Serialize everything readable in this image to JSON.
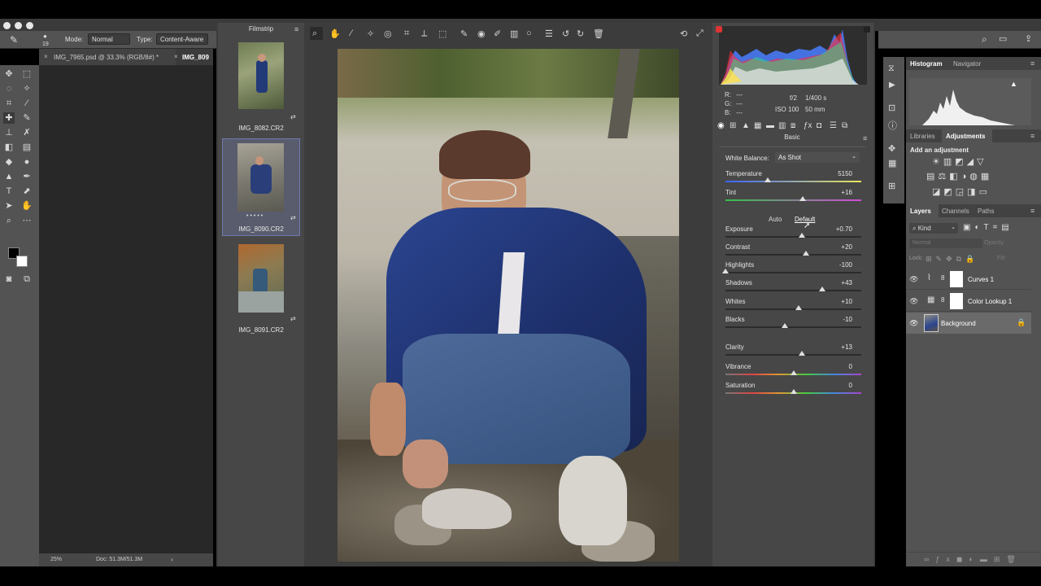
{
  "ps": {
    "options": {
      "mode_label": "Mode:",
      "mode_value": "Normal",
      "type_label": "Type:",
      "type_value": "Content-Aware",
      "brush_size": "19"
    },
    "doc_tabs": [
      {
        "label": "IMG_7965.psd @ 33.3% (RGB/8#) *"
      },
      {
        "label": "IMG_809"
      }
    ],
    "status": {
      "zoom": "25%",
      "doc": "Doc: 51.3M/51.3M"
    }
  },
  "filmstrip": {
    "title": "Filmstrip",
    "items": [
      {
        "name": "IMG_8082.CR2",
        "selected": false
      },
      {
        "name": "IMG_8090.CR2",
        "selected": true
      },
      {
        "name": "IMG_8091.CR2",
        "selected": false
      }
    ]
  },
  "acr": {
    "info": {
      "r": "R:",
      "g": "G:",
      "b": "B:",
      "dash": "---",
      "aperture": "f/2",
      "shutter": "1/400 s",
      "iso": "ISO 100",
      "focal": "50 mm"
    },
    "panel_title": "Basic",
    "white_balance": {
      "label": "White Balance:",
      "value": "As Shot"
    },
    "auto_label": "Auto",
    "default_label": "Default",
    "sliders": [
      {
        "label": "Temperature",
        "value": "5150",
        "pos": 0.31
      },
      {
        "label": "Tint",
        "value": "+16",
        "pos": 0.57
      },
      {
        "label": "Exposure",
        "value": "+0.70",
        "pos": 0.56
      },
      {
        "label": "Contrast",
        "value": "+20",
        "pos": 0.59
      },
      {
        "label": "Highlights",
        "value": "-100",
        "pos": 0.0
      },
      {
        "label": "Shadows",
        "value": "+43",
        "pos": 0.71
      },
      {
        "label": "Whites",
        "value": "+10",
        "pos": 0.54
      },
      {
        "label": "Blacks",
        "value": "-10",
        "pos": 0.44
      },
      {
        "label": "Clarity",
        "value": "+13",
        "pos": 0.56
      },
      {
        "label": "Vibrance",
        "value": "0",
        "pos": 0.5
      },
      {
        "label": "Saturation",
        "value": "0",
        "pos": 0.5
      }
    ]
  },
  "panels": {
    "histogram_tabs": [
      "Histogram",
      "Navigator"
    ],
    "adjust_tabs": [
      "Libraries",
      "Adjustments"
    ],
    "add_adjustment": "Add an adjustment",
    "layers_tabs": [
      "Layers",
      "Channels",
      "Paths"
    ],
    "kind": "Kind",
    "blend": "Normal",
    "opacity": "Opacity:",
    "lock": "Lock:",
    "fill": "Fill:",
    "layers": [
      {
        "name": "Curves 1"
      },
      {
        "name": "Color Lookup 1"
      },
      {
        "name": "Background"
      }
    ]
  }
}
